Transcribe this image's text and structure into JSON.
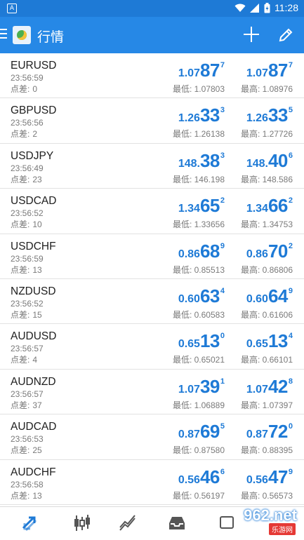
{
  "status_bar": {
    "left_icon": "A",
    "time": "11:28",
    "icons": [
      "wifi-icon",
      "signal-icon",
      "battery-icon"
    ]
  },
  "app_bar": {
    "title": "行情",
    "add_icon": "plus-icon",
    "edit_icon": "pencil-icon"
  },
  "colors": {
    "accent": "#1e7ad6",
    "header": "#2688e6"
  },
  "quotes": [
    {
      "symbol": "EURUSD",
      "time": "23:56:59",
      "spread_label": "点差:",
      "spread": "0",
      "bid": {
        "pre": "1.07",
        "big": "87",
        "sup": "7"
      },
      "ask": {
        "pre": "1.07",
        "big": "87",
        "sup": "7"
      },
      "low": "最低: 1.07803",
      "high": "最高: 1.08976"
    },
    {
      "symbol": "GBPUSD",
      "time": "23:56:56",
      "spread_label": "点差:",
      "spread": "2",
      "bid": {
        "pre": "1.26",
        "big": "33",
        "sup": "3"
      },
      "ask": {
        "pre": "1.26",
        "big": "33",
        "sup": "5"
      },
      "low": "最低: 1.26138",
      "high": "最高: 1.27726"
    },
    {
      "symbol": "USDJPY",
      "time": "23:56:49",
      "spread_label": "点差:",
      "spread": "23",
      "bid": {
        "pre": "148.",
        "big": "38",
        "sup": "3"
      },
      "ask": {
        "pre": "148.",
        "big": "40",
        "sup": "6"
      },
      "low": "最低: 146.198",
      "high": "最高: 148.586"
    },
    {
      "symbol": "USDCAD",
      "time": "23:56:52",
      "spread_label": "点差:",
      "spread": "10",
      "bid": {
        "pre": "1.34",
        "big": "65",
        "sup": "2"
      },
      "ask": {
        "pre": "1.34",
        "big": "66",
        "sup": "2"
      },
      "low": "最低: 1.33656",
      "high": "最高: 1.34753"
    },
    {
      "symbol": "USDCHF",
      "time": "23:56:59",
      "spread_label": "点差:",
      "spread": "13",
      "bid": {
        "pre": "0.86",
        "big": "68",
        "sup": "9"
      },
      "ask": {
        "pre": "0.86",
        "big": "70",
        "sup": "2"
      },
      "low": "最低: 0.85513",
      "high": "最高: 0.86806"
    },
    {
      "symbol": "NZDUSD",
      "time": "23:56:52",
      "spread_label": "点差:",
      "spread": "15",
      "bid": {
        "pre": "0.60",
        "big": "63",
        "sup": "4"
      },
      "ask": {
        "pre": "0.60",
        "big": "64",
        "sup": "9"
      },
      "low": "最低: 0.60583",
      "high": "最高: 0.61606"
    },
    {
      "symbol": "AUDUSD",
      "time": "23:56:57",
      "spread_label": "点差:",
      "spread": "4",
      "bid": {
        "pre": "0.65",
        "big": "13",
        "sup": "0"
      },
      "ask": {
        "pre": "0.65",
        "big": "13",
        "sup": "4"
      },
      "low": "最低: 0.65021",
      "high": "最高: 0.66101"
    },
    {
      "symbol": "AUDNZD",
      "time": "23:56:57",
      "spread_label": "点差:",
      "spread": "37",
      "bid": {
        "pre": "1.07",
        "big": "39",
        "sup": "1"
      },
      "ask": {
        "pre": "1.07",
        "big": "42",
        "sup": "8"
      },
      "low": "最低: 1.06889",
      "high": "最高: 1.07397"
    },
    {
      "symbol": "AUDCAD",
      "time": "23:56:53",
      "spread_label": "点差:",
      "spread": "25",
      "bid": {
        "pre": "0.87",
        "big": "69",
        "sup": "5"
      },
      "ask": {
        "pre": "0.87",
        "big": "72",
        "sup": "0"
      },
      "low": "最低: 0.87580",
      "high": "最高: 0.88395"
    },
    {
      "symbol": "AUDCHF",
      "time": "23:56:58",
      "spread_label": "点差:",
      "spread": "13",
      "bid": {
        "pre": "0.56",
        "big": "46",
        "sup": "6"
      },
      "ask": {
        "pre": "0.56",
        "big": "47",
        "sup": "9"
      },
      "low": "最低: 0.56197",
      "high": "最高: 0.56573"
    }
  ],
  "bottom_tabs": [
    {
      "name": "quotes-tab",
      "icon": "arrows-icon",
      "active": true
    },
    {
      "name": "chart-tab",
      "icon": "candlestick-icon",
      "active": false
    },
    {
      "name": "trade-tab",
      "icon": "trend-icon",
      "active": false
    },
    {
      "name": "history-tab",
      "icon": "inbox-icon",
      "active": false
    },
    {
      "name": "messages-tab",
      "icon": "message-icon",
      "active": false
    }
  ],
  "watermark": {
    "main": "962.net",
    "sub": "乐游网"
  }
}
